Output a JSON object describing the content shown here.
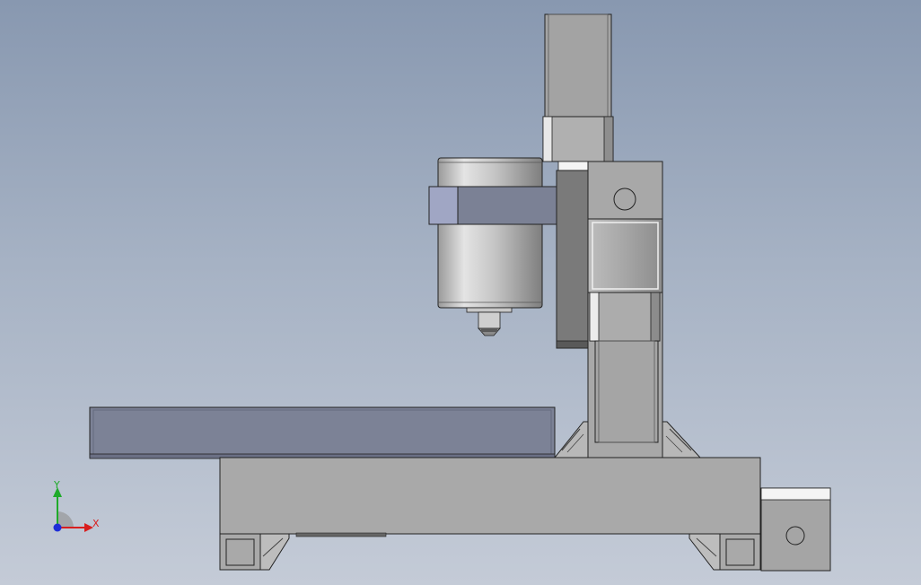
{
  "viewport": {
    "background_top": "#8898b0",
    "background_bottom": "#c4cbd7"
  },
  "triad": {
    "y_label": "Y",
    "x_label": "X",
    "y_color": "#1faa2a",
    "x_color": "#d81e1e",
    "z_color": "#1e2ed8"
  },
  "model": {
    "parts": [
      "stepper-motor-z",
      "spindle-motor",
      "spindle-clamp",
      "z-carriage",
      "column",
      "stepper-motor-y",
      "worktable",
      "base-frame",
      "stepper-motor-x"
    ]
  }
}
